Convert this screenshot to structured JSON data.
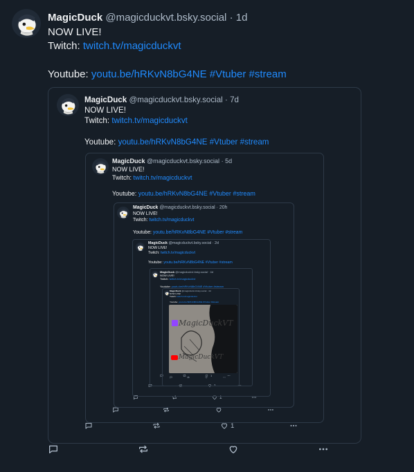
{
  "levels": [
    {
      "name": "MagicDuck",
      "handle": "@magicduckvt.bsky.social",
      "sep": "·",
      "time": "1d",
      "status": "NOW LIVE!",
      "twitch_label": "Twitch:",
      "twitch_link": "twitch.tv/magicduckvt",
      "youtube_label": "Youtube:",
      "youtube_link": "youtu.be/hRKvN8bG4NE",
      "tag1": "#Vtuber",
      "tag2": "#stream",
      "likes": ""
    },
    {
      "name": "MagicDuck",
      "handle": "@magicduckvt.bsky.social",
      "sep": "·",
      "time": "7d",
      "status": "NOW LIVE!",
      "twitch_label": "Twitch:",
      "twitch_link": "twitch.tv/magicduckvt",
      "youtube_label": "Youtube:",
      "youtube_link": "youtu.be/hRKvN8bG4NE",
      "tag1": "#Vtuber",
      "tag2": "#stream",
      "likes": "1"
    },
    {
      "name": "MagicDuck",
      "handle": "@magicduckvt.bsky.social",
      "sep": "·",
      "time": "5d",
      "status": "NOW LIVE!",
      "twitch_label": "Twitch:",
      "twitch_link": "twitch.tv/magicduckvt",
      "youtube_label": "Youtube:",
      "youtube_link": "youtu.be/hRKvN8bG4NE",
      "tag1": "#Vtuber",
      "tag2": "#stream",
      "likes": ""
    },
    {
      "name": "MagicDuck",
      "handle": "@magicduckvt.bsky.social",
      "sep": "·",
      "time": "20h",
      "status": "NOW LIVE!",
      "twitch_label": "Twitch:",
      "twitch_link": "twitch.tv/magicduckvt",
      "youtube_label": "Youtube:",
      "youtube_link": "youtu.be/hRKvN8bG4NE",
      "tag1": "#Vtuber",
      "tag2": "#stream",
      "likes": "1"
    },
    {
      "name": "MagicDuck",
      "handle": "@magicduckvt.bsky.social",
      "sep": "·",
      "time": "2d",
      "status": "NOW LIVE!",
      "twitch_label": "Twitch:",
      "twitch_link": "twitch.tv/magicduckvt",
      "youtube_label": "Youtube:",
      "youtube_link": "youtu.be/hRKvN8bG4NE",
      "tag1": "#Vtuber",
      "tag2": "#stream",
      "likes": "1"
    },
    {
      "name": "MagicDuck",
      "handle": "@magicduckvt.bsky.social",
      "sep": "·",
      "time": "4d",
      "status": "NOW LIVE!",
      "twitch_label": "Twitch:",
      "twitch_link": "twitch.tv/magicduckvt",
      "youtube_label": "Youtube:",
      "youtube_link": "youtu.be/hRKvN8bG4NE",
      "tag1": "#Vtuber",
      "tag2": "#stream",
      "likes": "1"
    },
    {
      "name": "MagicDuck",
      "handle": "@magicduckvt.bsky.social",
      "sep": "·",
      "time": "4d",
      "status": "NOW LIVE!",
      "twitch_label": "Twitch:",
      "twitch_link": "twitch.tv/magicduckvt",
      "youtube_label": "Youtube:",
      "youtube_link": "youtu.be/hRKvN8bG4NE",
      "tag1": "#Vtuber",
      "tag2": "#stream",
      "likes": ""
    }
  ],
  "thumbnail": {
    "watermark": "MagicDuckVT"
  },
  "icons": {
    "reply": "reply-icon",
    "repost": "repost-icon",
    "like": "like-icon",
    "more": "more-icon"
  },
  "colors": {
    "background": "#161e27",
    "link": "#208bfe",
    "muted": "#aebbc9",
    "border": "#2e3a48",
    "text": "#f1f3f5"
  }
}
